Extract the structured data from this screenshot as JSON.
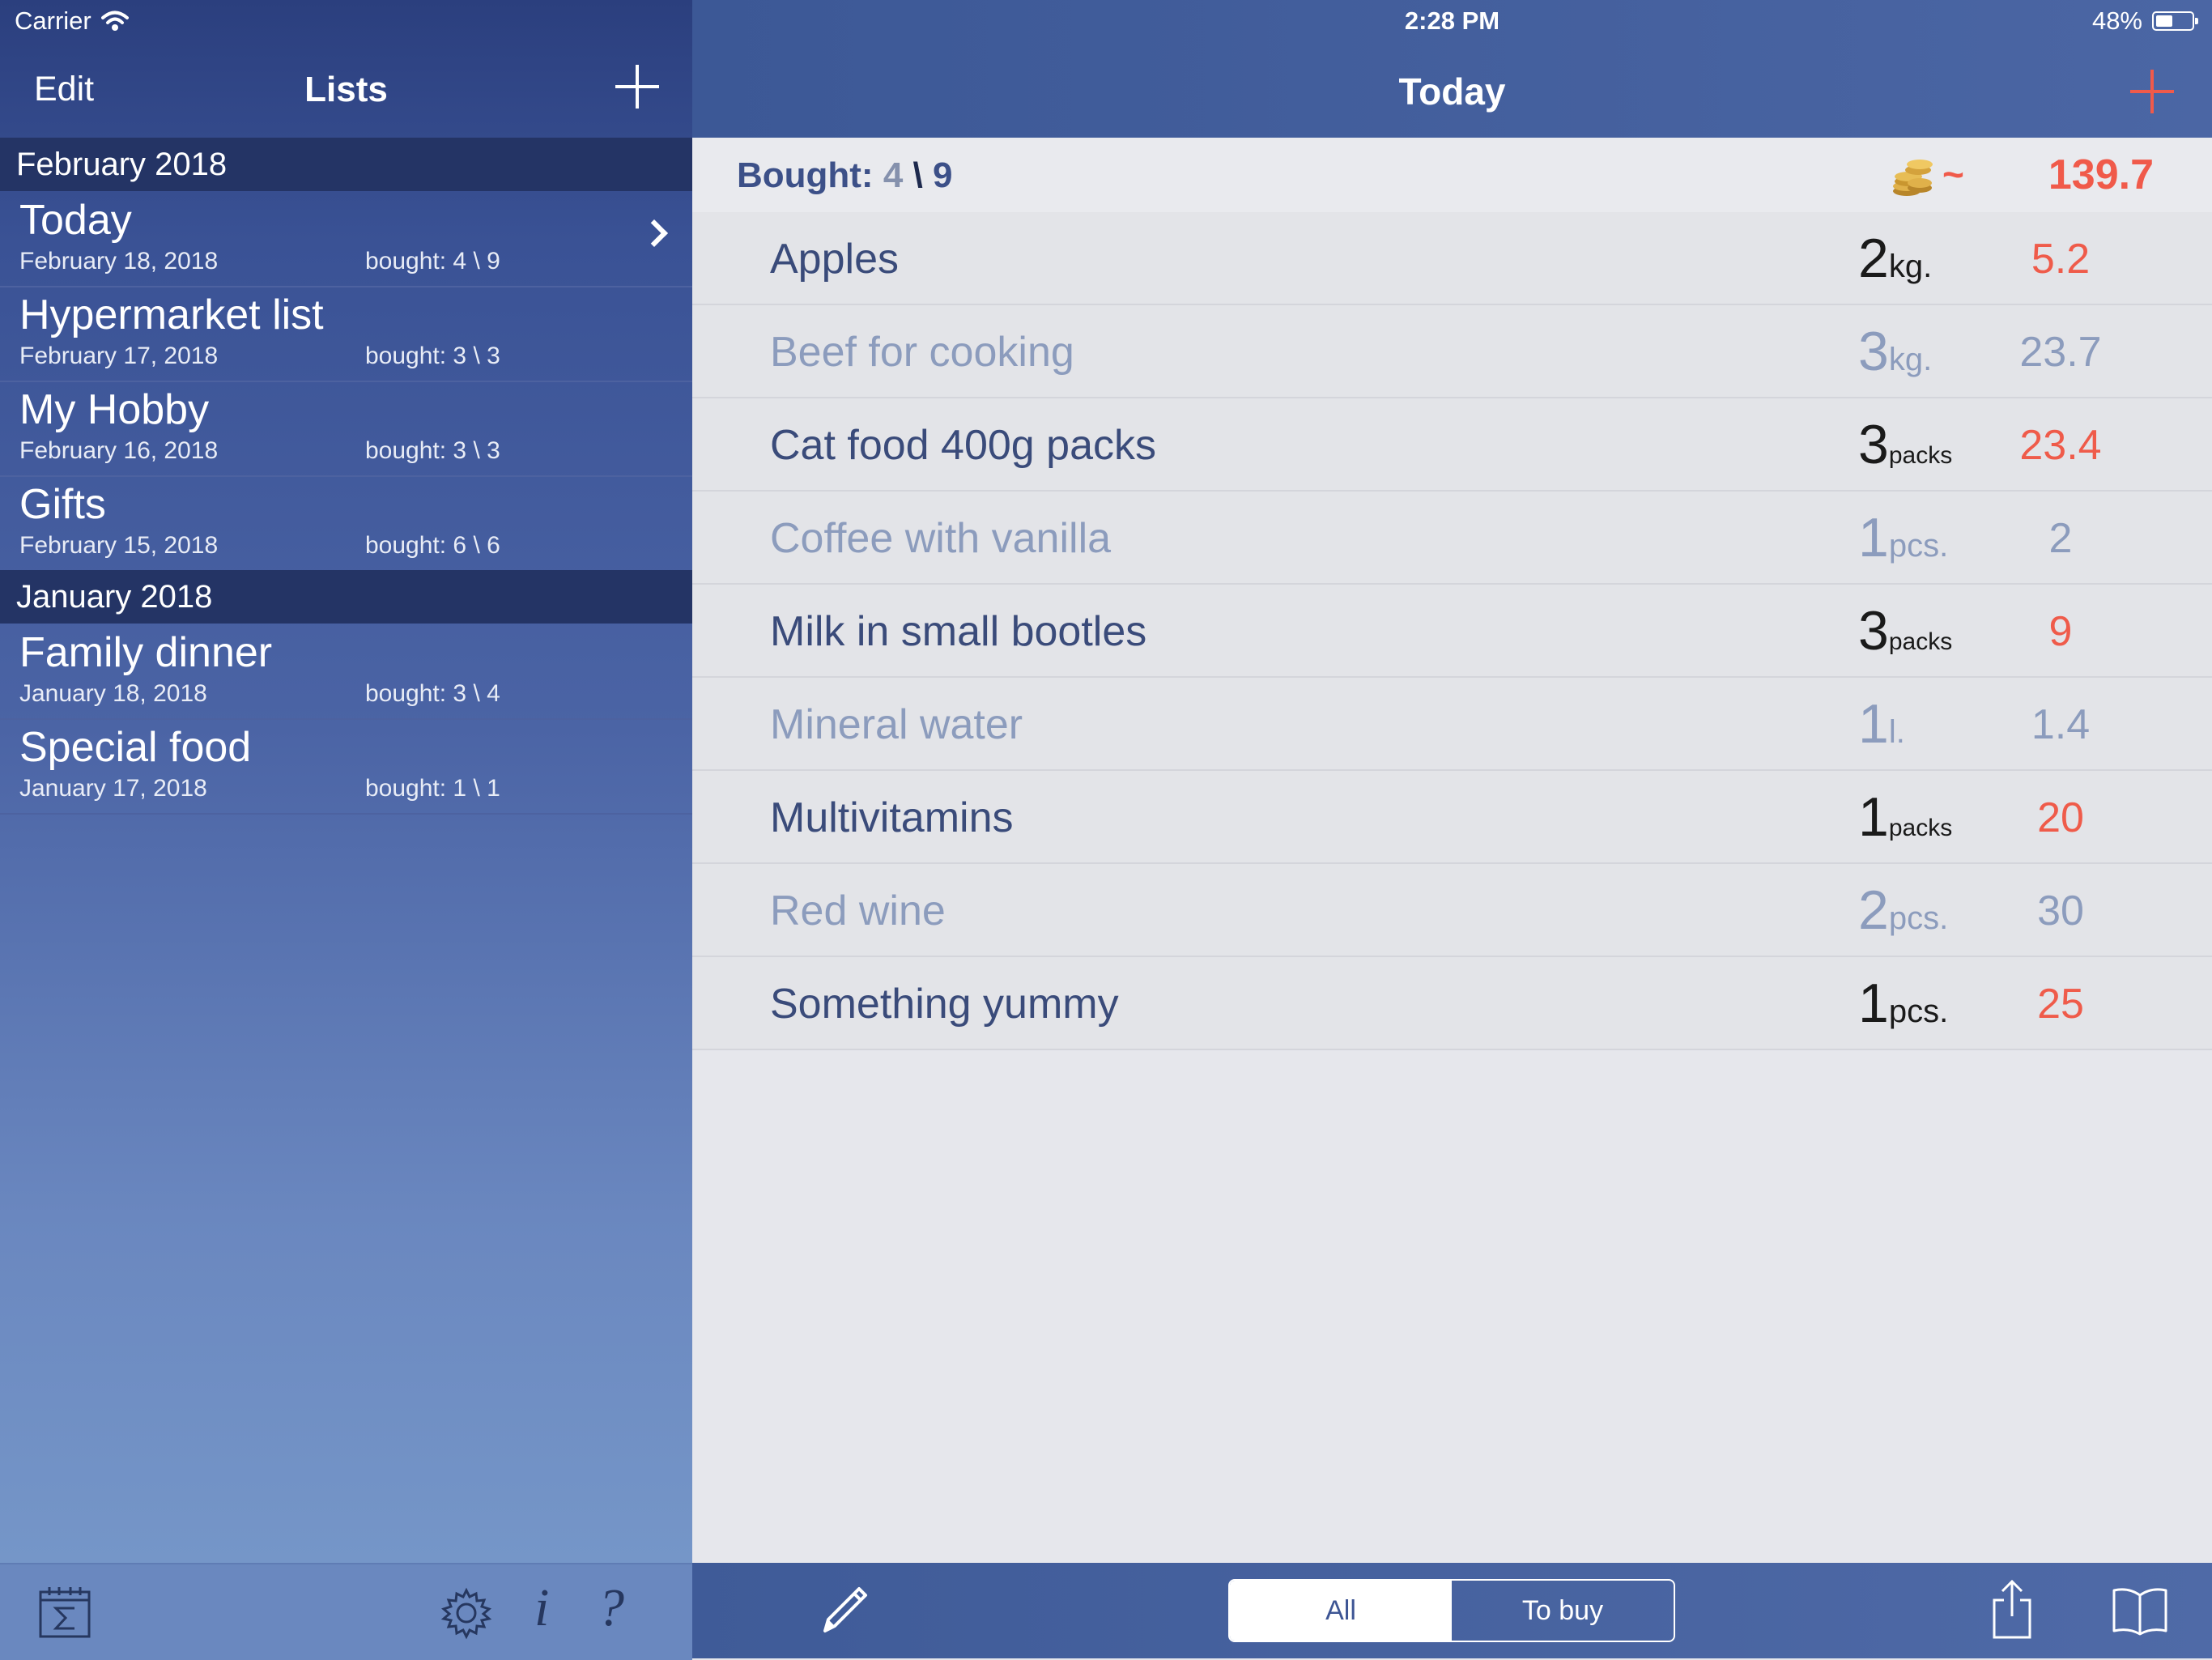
{
  "status": {
    "carrier": "Carrier",
    "time": "2:28 PM",
    "battery": "48%",
    "battery_level": 0.48
  },
  "sidebar": {
    "edit_label": "Edit",
    "title": "Lists",
    "sections": [
      {
        "header": "February 2018",
        "lists": [
          {
            "name": "Today",
            "date": "February 18, 2018",
            "bought": "bought: 4 \\ 9",
            "selected": true
          },
          {
            "name": "Hypermarket list",
            "date": "February 17, 2018",
            "bought": "bought: 3 \\ 3"
          },
          {
            "name": "My Hobby",
            "date": "February 16, 2018",
            "bought": "bought: 3 \\ 3"
          },
          {
            "name": "Gifts",
            "date": "February 15, 2018",
            "bought": "bought: 6 \\ 6"
          }
        ]
      },
      {
        "header": "January 2018",
        "lists": [
          {
            "name": "Family dinner",
            "date": "January 18, 2018",
            "bought": "bought: 3 \\ 4"
          },
          {
            "name": "Special food",
            "date": "January 17, 2018",
            "bought": "bought: 1 \\ 1"
          }
        ]
      }
    ],
    "toolbar": {
      "info_glyph": "i",
      "help_glyph": "?"
    }
  },
  "main": {
    "title": "Today",
    "summary": {
      "label": "Bought:",
      "bought": "4",
      "separator": "\\",
      "total": "9",
      "tilde": "~",
      "price": "139.7"
    },
    "items": [
      {
        "name": "Apples",
        "qty": "2",
        "unit": "kg.",
        "price": "5.2",
        "bought": false
      },
      {
        "name": "Beef for cooking",
        "qty": "3",
        "unit": "kg.",
        "price": "23.7",
        "bought": true
      },
      {
        "name": "Cat food 400g packs",
        "qty": "3",
        "unit": "packs",
        "price": "23.4",
        "bought": false
      },
      {
        "name": "Coffee with vanilla",
        "qty": "1",
        "unit": "pcs.",
        "price": "2",
        "bought": true
      },
      {
        "name": "Milk in small bootles",
        "qty": "3",
        "unit": "packs",
        "price": "9",
        "bought": false
      },
      {
        "name": "Mineral water",
        "qty": "1",
        "unit": "l.",
        "price": "1.4",
        "bought": true
      },
      {
        "name": "Multivitamins",
        "qty": "1",
        "unit": "packs",
        "price": "20",
        "bought": false
      },
      {
        "name": "Red wine",
        "qty": "2",
        "unit": "pcs.",
        "price": "30",
        "bought": true
      },
      {
        "name": "Something yummy",
        "qty": "1",
        "unit": "pcs.",
        "price": "25",
        "bought": false
      }
    ],
    "filter": {
      "all": "All",
      "to_buy": "To buy",
      "selected": "all"
    }
  },
  "colors": {
    "accent_red": "#ef5b4a",
    "nav_blue": "#3c5896",
    "section_dark": "#243465"
  },
  "icons": [
    "wifi-icon",
    "battery-icon",
    "plus-icon",
    "chevron-right-icon",
    "calendar-sum-icon",
    "gear-icon",
    "info-icon",
    "help-icon",
    "coins-icon",
    "pencil-icon",
    "share-icon",
    "book-icon"
  ]
}
